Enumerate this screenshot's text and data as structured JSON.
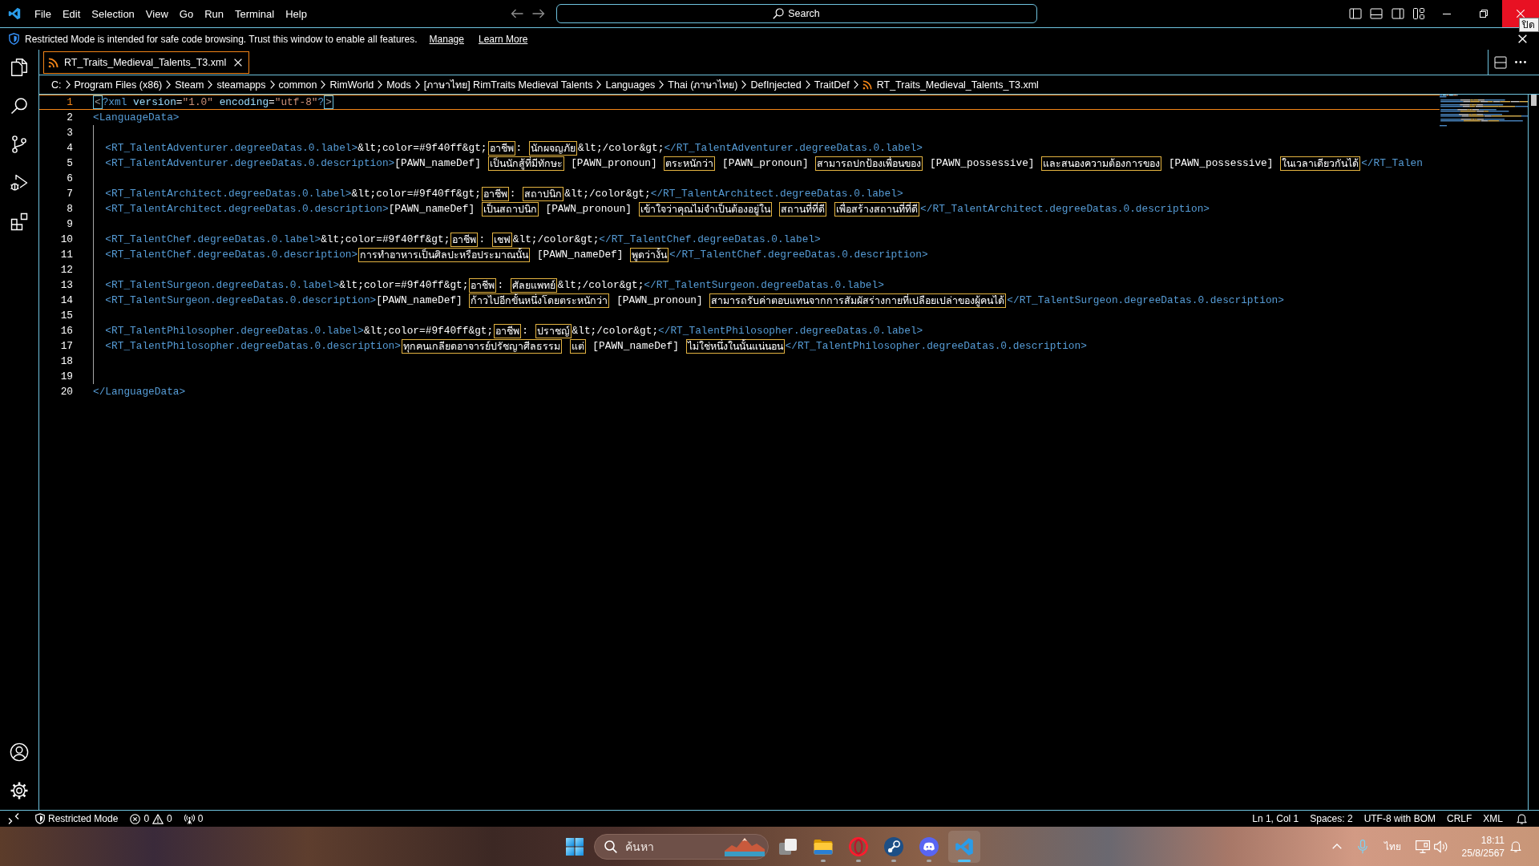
{
  "title_bar": {
    "menus": [
      "File",
      "Edit",
      "Selection",
      "View",
      "Go",
      "Run",
      "Terminal",
      "Help"
    ],
    "command_center": {
      "label": "Search"
    },
    "close_hovered": true,
    "tooltip": "ปิด"
  },
  "banner": {
    "message": "Restricted Mode is intended for safe code browsing. Trust this window to enable all features.",
    "links": [
      "Manage",
      "Learn More"
    ]
  },
  "tabs": [
    {
      "label": "RT_Traits_Medieval_Talents_T3.xml",
      "selected": true
    }
  ],
  "breadcrumb": [
    {
      "kind": "folder",
      "label": "C:"
    },
    {
      "kind": "folder",
      "label": "Program Files (x86)"
    },
    {
      "kind": "folder",
      "label": "Steam"
    },
    {
      "kind": "folder",
      "label": "steamapps"
    },
    {
      "kind": "folder",
      "label": "common"
    },
    {
      "kind": "folder",
      "label": "RimWorld"
    },
    {
      "kind": "folder",
      "label": "Mods"
    },
    {
      "kind": "folder",
      "label": "[ภาษาไทย] RimTraits Medieval Talents"
    },
    {
      "kind": "folder",
      "label": "Languages"
    },
    {
      "kind": "folder",
      "label": "Thai (ภาษาไทย)"
    },
    {
      "kind": "folder",
      "label": "DefInjected"
    },
    {
      "kind": "folder",
      "label": "TraitDef"
    },
    {
      "kind": "file",
      "label": "RT_Traits_Medieval_Talents_T3.xml"
    }
  ],
  "editor": {
    "lines": [
      {
        "number": "1",
        "current": true,
        "tokens": [
          {
            "kind": "bracket",
            "text": "<"
          },
          {
            "kind": "tag",
            "text": "?xml"
          },
          {
            "kind": "attr",
            "text": " version"
          },
          {
            "kind": "text",
            "text": "="
          },
          {
            "kind": "string",
            "text": "\"1.0\""
          },
          {
            "kind": "attr",
            "text": " encoding"
          },
          {
            "kind": "text",
            "text": "="
          },
          {
            "kind": "string",
            "text": "\"utf-8\""
          },
          {
            "kind": "tag",
            "text": "?"
          },
          {
            "kind": "bracket",
            "text": ">"
          }
        ]
      },
      {
        "number": "2",
        "current": false,
        "tokens": [
          {
            "kind": "tag",
            "text": "<LanguageData>"
          }
        ]
      },
      {
        "number": "3",
        "current": false
      },
      {
        "number": "4",
        "current": false,
        "tokens": [
          {
            "kind": "tag",
            "text": "  <RT_TalentAdventurer.degreeDatas.0.label>"
          },
          {
            "kind": "text",
            "text": "&lt;color=#9f40ff&gt;"
          },
          {
            "kind": "highlight",
            "text": "อาชีพ"
          },
          {
            "kind": "text",
            "text": ": "
          },
          {
            "kind": "highlight",
            "text": "นักผจญภัย"
          },
          {
            "kind": "text",
            "text": "&lt;/color&gt;"
          },
          {
            "kind": "tag",
            "text": "</RT_TalentAdventurer.degreeDatas.0.label>"
          }
        ]
      },
      {
        "number": "5",
        "current": false,
        "tokens": [
          {
            "kind": "tag",
            "text": "  <RT_TalentAdventurer.degreeDatas.0.description>"
          },
          {
            "kind": "text",
            "text": "[PAWN_nameDef] "
          },
          {
            "kind": "highlight",
            "text": "เป็นนักสู้ที่มีทักษะ"
          },
          {
            "kind": "text",
            "text": " [PAWN_pronoun] "
          },
          {
            "kind": "highlight",
            "text": "ตระหนักว่า"
          },
          {
            "kind": "text",
            "text": " [PAWN_pronoun] "
          },
          {
            "kind": "highlight",
            "text": "สามารถปกป้องเพื่อนของ"
          },
          {
            "kind": "text",
            "text": " [PAWN_possessive] "
          },
          {
            "kind": "highlight",
            "text": "และสนองความต้องการของ"
          },
          {
            "kind": "text",
            "text": " [PAWN_possessive] "
          },
          {
            "kind": "highlight",
            "text": "ในเวลาเดียวกันได้"
          },
          {
            "kind": "tag",
            "text": "</RT_Talen"
          }
        ]
      },
      {
        "number": "6",
        "current": false
      },
      {
        "number": "7",
        "current": false,
        "tokens": [
          {
            "kind": "tag",
            "text": "  <RT_TalentArchitect.degreeDatas.0.label>"
          },
          {
            "kind": "text",
            "text": "&lt;color=#9f40ff&gt;"
          },
          {
            "kind": "highlight",
            "text": "อาชีพ"
          },
          {
            "kind": "text",
            "text": ": "
          },
          {
            "kind": "highlight",
            "text": "สถาปนิก"
          },
          {
            "kind": "text",
            "text": "&lt;/color&gt;"
          },
          {
            "kind": "tag",
            "text": "</RT_TalentArchitect.degreeDatas.0.label>"
          }
        ]
      },
      {
        "number": "8",
        "current": false,
        "tokens": [
          {
            "kind": "tag",
            "text": "  <RT_TalentArchitect.degreeDatas.0.description>"
          },
          {
            "kind": "text",
            "text": "[PAWN_nameDef] "
          },
          {
            "kind": "highlight",
            "text": "เป็นสถาปนิก"
          },
          {
            "kind": "text",
            "text": " [PAWN_pronoun] "
          },
          {
            "kind": "highlight",
            "text": "เข้าใจว่าคุณไม่จำเป็นต้องอยู่ใน "
          },
          {
            "kind": "highlight",
            "text": "สถานที่ที่ดี "
          },
          {
            "kind": "highlight",
            "text": "เพื่อสร้างสถานที่ที่ดี"
          },
          {
            "kind": "tag",
            "text": "</RT_TalentArchitect.degreeDatas.0.description>"
          }
        ]
      },
      {
        "number": "9",
        "current": false
      },
      {
        "number": "10",
        "current": false,
        "tokens": [
          {
            "kind": "tag",
            "text": "  <RT_TalentChef.degreeDatas.0.label>"
          },
          {
            "kind": "text",
            "text": "&lt;color=#9f40ff&gt;"
          },
          {
            "kind": "highlight",
            "text": "อาชีพ"
          },
          {
            "kind": "text",
            "text": ": "
          },
          {
            "kind": "highlight",
            "text": "เชฟ"
          },
          {
            "kind": "text",
            "text": "&lt;/color&gt;"
          },
          {
            "kind": "tag",
            "text": "</RT_TalentChef.degreeDatas.0.label>"
          }
        ]
      },
      {
        "number": "11",
        "current": false,
        "tokens": [
          {
            "kind": "tag",
            "text": "  <RT_TalentChef.degreeDatas.0.description>"
          },
          {
            "kind": "highlight",
            "text": "การทำอาหารเป็นศิลปะหรือประมาณนั้น"
          },
          {
            "kind": "text",
            "text": " [PAWN_nameDef] "
          },
          {
            "kind": "highlight",
            "text": "พูดว่างั้น"
          },
          {
            "kind": "tag",
            "text": "</RT_TalentChef.degreeDatas.0.description>"
          }
        ]
      },
      {
        "number": "12",
        "current": false
      },
      {
        "number": "13",
        "current": false,
        "tokens": [
          {
            "kind": "tag",
            "text": "  <RT_TalentSurgeon.degreeDatas.0.label>"
          },
          {
            "kind": "text",
            "text": "&lt;color=#9f40ff&gt;"
          },
          {
            "kind": "highlight",
            "text": "อาชีพ"
          },
          {
            "kind": "text",
            "text": ": "
          },
          {
            "kind": "highlight",
            "text": "ศัลยแพทย์"
          },
          {
            "kind": "text",
            "text": "&lt;/color&gt;"
          },
          {
            "kind": "tag",
            "text": "</RT_TalentSurgeon.degreeDatas.0.label>"
          }
        ]
      },
      {
        "number": "14",
        "current": false,
        "tokens": [
          {
            "kind": "tag",
            "text": "  <RT_TalentSurgeon.degreeDatas.0.description>"
          },
          {
            "kind": "text",
            "text": "[PAWN_nameDef] "
          },
          {
            "kind": "highlight",
            "text": "ก้าวไปอีกขั้นหนึ่งโดยตระหนักว่า"
          },
          {
            "kind": "text",
            "text": " [PAWN_pronoun] "
          },
          {
            "kind": "highlight",
            "text": "สามารถรับค่าตอบแทนจากการสัมผัสร่างกายที่เปลือยเปล่าของผู้คนได้"
          },
          {
            "kind": "tag",
            "text": "</RT_TalentSurgeon.degreeDatas.0.description>"
          }
        ]
      },
      {
        "number": "15",
        "current": false
      },
      {
        "number": "16",
        "current": false,
        "tokens": [
          {
            "kind": "tag",
            "text": "  <RT_TalentPhilosopher.degreeDatas.0.label>"
          },
          {
            "kind": "text",
            "text": "&lt;color=#9f40ff&gt;"
          },
          {
            "kind": "highlight",
            "text": "อาชีพ"
          },
          {
            "kind": "text",
            "text": ": "
          },
          {
            "kind": "highlight",
            "text": "ปราชญ์"
          },
          {
            "kind": "text",
            "text": "&lt;/color&gt;"
          },
          {
            "kind": "tag",
            "text": "</RT_TalentPhilosopher.degreeDatas.0.label>"
          }
        ]
      },
      {
        "number": "17",
        "current": false,
        "tokens": [
          {
            "kind": "tag",
            "text": "  <RT_TalentPhilosopher.degreeDatas.0.description>"
          },
          {
            "kind": "highlight",
            "text": "ทุกคนเกลียดอาจารย์ปรัชญาศีลธรรม "
          },
          {
            "kind": "highlight",
            "text": "แต่"
          },
          {
            "kind": "text",
            "text": " [PAWN_nameDef] "
          },
          {
            "kind": "highlight",
            "text": "ไม่ใช่หนึ่งในนั้นแน่นอน"
          },
          {
            "kind": "tag",
            "text": "</RT_TalentPhilosopher.degreeDatas.0.description>"
          }
        ]
      },
      {
        "number": "18",
        "current": false
      },
      {
        "number": "19",
        "current": false
      },
      {
        "number": "20",
        "current": false,
        "tokens": [
          {
            "kind": "tag",
            "text": "</LanguageData>"
          }
        ]
      }
    ]
  },
  "status_bar": {
    "left": [
      {
        "kind": "remote"
      },
      {
        "kind": "restricted",
        "label": "Restricted Mode"
      },
      {
        "kind": "problems",
        "errors": "0",
        "warnings": "0"
      },
      {
        "kind": "ports",
        "label": "0"
      }
    ],
    "right": [
      "Ln 1, Col 1",
      "Spaces: 2",
      "UTF-8 with BOM",
      "CRLF",
      "XML"
    ]
  },
  "taskbar": {
    "search": {
      "placeholder": "ค้นหา"
    },
    "apps": [
      {
        "kind": "task-view",
        "running": false,
        "selected": false
      },
      {
        "kind": "files",
        "running": true,
        "selected": false
      },
      {
        "kind": "browser",
        "running": true,
        "selected": false
      },
      {
        "kind": "game-store",
        "running": true,
        "selected": false
      },
      {
        "kind": "chat",
        "running": true,
        "selected": false
      },
      {
        "kind": "editor",
        "running": true,
        "selected": true
      }
    ],
    "language": "ไทย",
    "time": "18:11",
    "date": "25/8/2567"
  }
}
